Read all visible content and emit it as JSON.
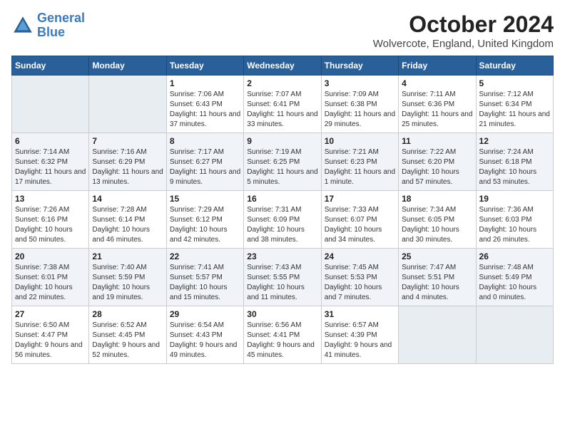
{
  "header": {
    "logo_line1": "General",
    "logo_line2": "Blue",
    "month": "October 2024",
    "location": "Wolvercote, England, United Kingdom"
  },
  "weekdays": [
    "Sunday",
    "Monday",
    "Tuesday",
    "Wednesday",
    "Thursday",
    "Friday",
    "Saturday"
  ],
  "weeks": [
    [
      {
        "day": "",
        "detail": ""
      },
      {
        "day": "",
        "detail": ""
      },
      {
        "day": "1",
        "detail": "Sunrise: 7:06 AM\nSunset: 6:43 PM\nDaylight: 11 hours and 37 minutes."
      },
      {
        "day": "2",
        "detail": "Sunrise: 7:07 AM\nSunset: 6:41 PM\nDaylight: 11 hours and 33 minutes."
      },
      {
        "day": "3",
        "detail": "Sunrise: 7:09 AM\nSunset: 6:38 PM\nDaylight: 11 hours and 29 minutes."
      },
      {
        "day": "4",
        "detail": "Sunrise: 7:11 AM\nSunset: 6:36 PM\nDaylight: 11 hours and 25 minutes."
      },
      {
        "day": "5",
        "detail": "Sunrise: 7:12 AM\nSunset: 6:34 PM\nDaylight: 11 hours and 21 minutes."
      }
    ],
    [
      {
        "day": "6",
        "detail": "Sunrise: 7:14 AM\nSunset: 6:32 PM\nDaylight: 11 hours and 17 minutes."
      },
      {
        "day": "7",
        "detail": "Sunrise: 7:16 AM\nSunset: 6:29 PM\nDaylight: 11 hours and 13 minutes."
      },
      {
        "day": "8",
        "detail": "Sunrise: 7:17 AM\nSunset: 6:27 PM\nDaylight: 11 hours and 9 minutes."
      },
      {
        "day": "9",
        "detail": "Sunrise: 7:19 AM\nSunset: 6:25 PM\nDaylight: 11 hours and 5 minutes."
      },
      {
        "day": "10",
        "detail": "Sunrise: 7:21 AM\nSunset: 6:23 PM\nDaylight: 11 hours and 1 minute."
      },
      {
        "day": "11",
        "detail": "Sunrise: 7:22 AM\nSunset: 6:20 PM\nDaylight: 10 hours and 57 minutes."
      },
      {
        "day": "12",
        "detail": "Sunrise: 7:24 AM\nSunset: 6:18 PM\nDaylight: 10 hours and 53 minutes."
      }
    ],
    [
      {
        "day": "13",
        "detail": "Sunrise: 7:26 AM\nSunset: 6:16 PM\nDaylight: 10 hours and 50 minutes."
      },
      {
        "day": "14",
        "detail": "Sunrise: 7:28 AM\nSunset: 6:14 PM\nDaylight: 10 hours and 46 minutes."
      },
      {
        "day": "15",
        "detail": "Sunrise: 7:29 AM\nSunset: 6:12 PM\nDaylight: 10 hours and 42 minutes."
      },
      {
        "day": "16",
        "detail": "Sunrise: 7:31 AM\nSunset: 6:09 PM\nDaylight: 10 hours and 38 minutes."
      },
      {
        "day": "17",
        "detail": "Sunrise: 7:33 AM\nSunset: 6:07 PM\nDaylight: 10 hours and 34 minutes."
      },
      {
        "day": "18",
        "detail": "Sunrise: 7:34 AM\nSunset: 6:05 PM\nDaylight: 10 hours and 30 minutes."
      },
      {
        "day": "19",
        "detail": "Sunrise: 7:36 AM\nSunset: 6:03 PM\nDaylight: 10 hours and 26 minutes."
      }
    ],
    [
      {
        "day": "20",
        "detail": "Sunrise: 7:38 AM\nSunset: 6:01 PM\nDaylight: 10 hours and 22 minutes."
      },
      {
        "day": "21",
        "detail": "Sunrise: 7:40 AM\nSunset: 5:59 PM\nDaylight: 10 hours and 19 minutes."
      },
      {
        "day": "22",
        "detail": "Sunrise: 7:41 AM\nSunset: 5:57 PM\nDaylight: 10 hours and 15 minutes."
      },
      {
        "day": "23",
        "detail": "Sunrise: 7:43 AM\nSunset: 5:55 PM\nDaylight: 10 hours and 11 minutes."
      },
      {
        "day": "24",
        "detail": "Sunrise: 7:45 AM\nSunset: 5:53 PM\nDaylight: 10 hours and 7 minutes."
      },
      {
        "day": "25",
        "detail": "Sunrise: 7:47 AM\nSunset: 5:51 PM\nDaylight: 10 hours and 4 minutes."
      },
      {
        "day": "26",
        "detail": "Sunrise: 7:48 AM\nSunset: 5:49 PM\nDaylight: 10 hours and 0 minutes."
      }
    ],
    [
      {
        "day": "27",
        "detail": "Sunrise: 6:50 AM\nSunset: 4:47 PM\nDaylight: 9 hours and 56 minutes."
      },
      {
        "day": "28",
        "detail": "Sunrise: 6:52 AM\nSunset: 4:45 PM\nDaylight: 9 hours and 52 minutes."
      },
      {
        "day": "29",
        "detail": "Sunrise: 6:54 AM\nSunset: 4:43 PM\nDaylight: 9 hours and 49 minutes."
      },
      {
        "day": "30",
        "detail": "Sunrise: 6:56 AM\nSunset: 4:41 PM\nDaylight: 9 hours and 45 minutes."
      },
      {
        "day": "31",
        "detail": "Sunrise: 6:57 AM\nSunset: 4:39 PM\nDaylight: 9 hours and 41 minutes."
      },
      {
        "day": "",
        "detail": ""
      },
      {
        "day": "",
        "detail": ""
      }
    ]
  ]
}
